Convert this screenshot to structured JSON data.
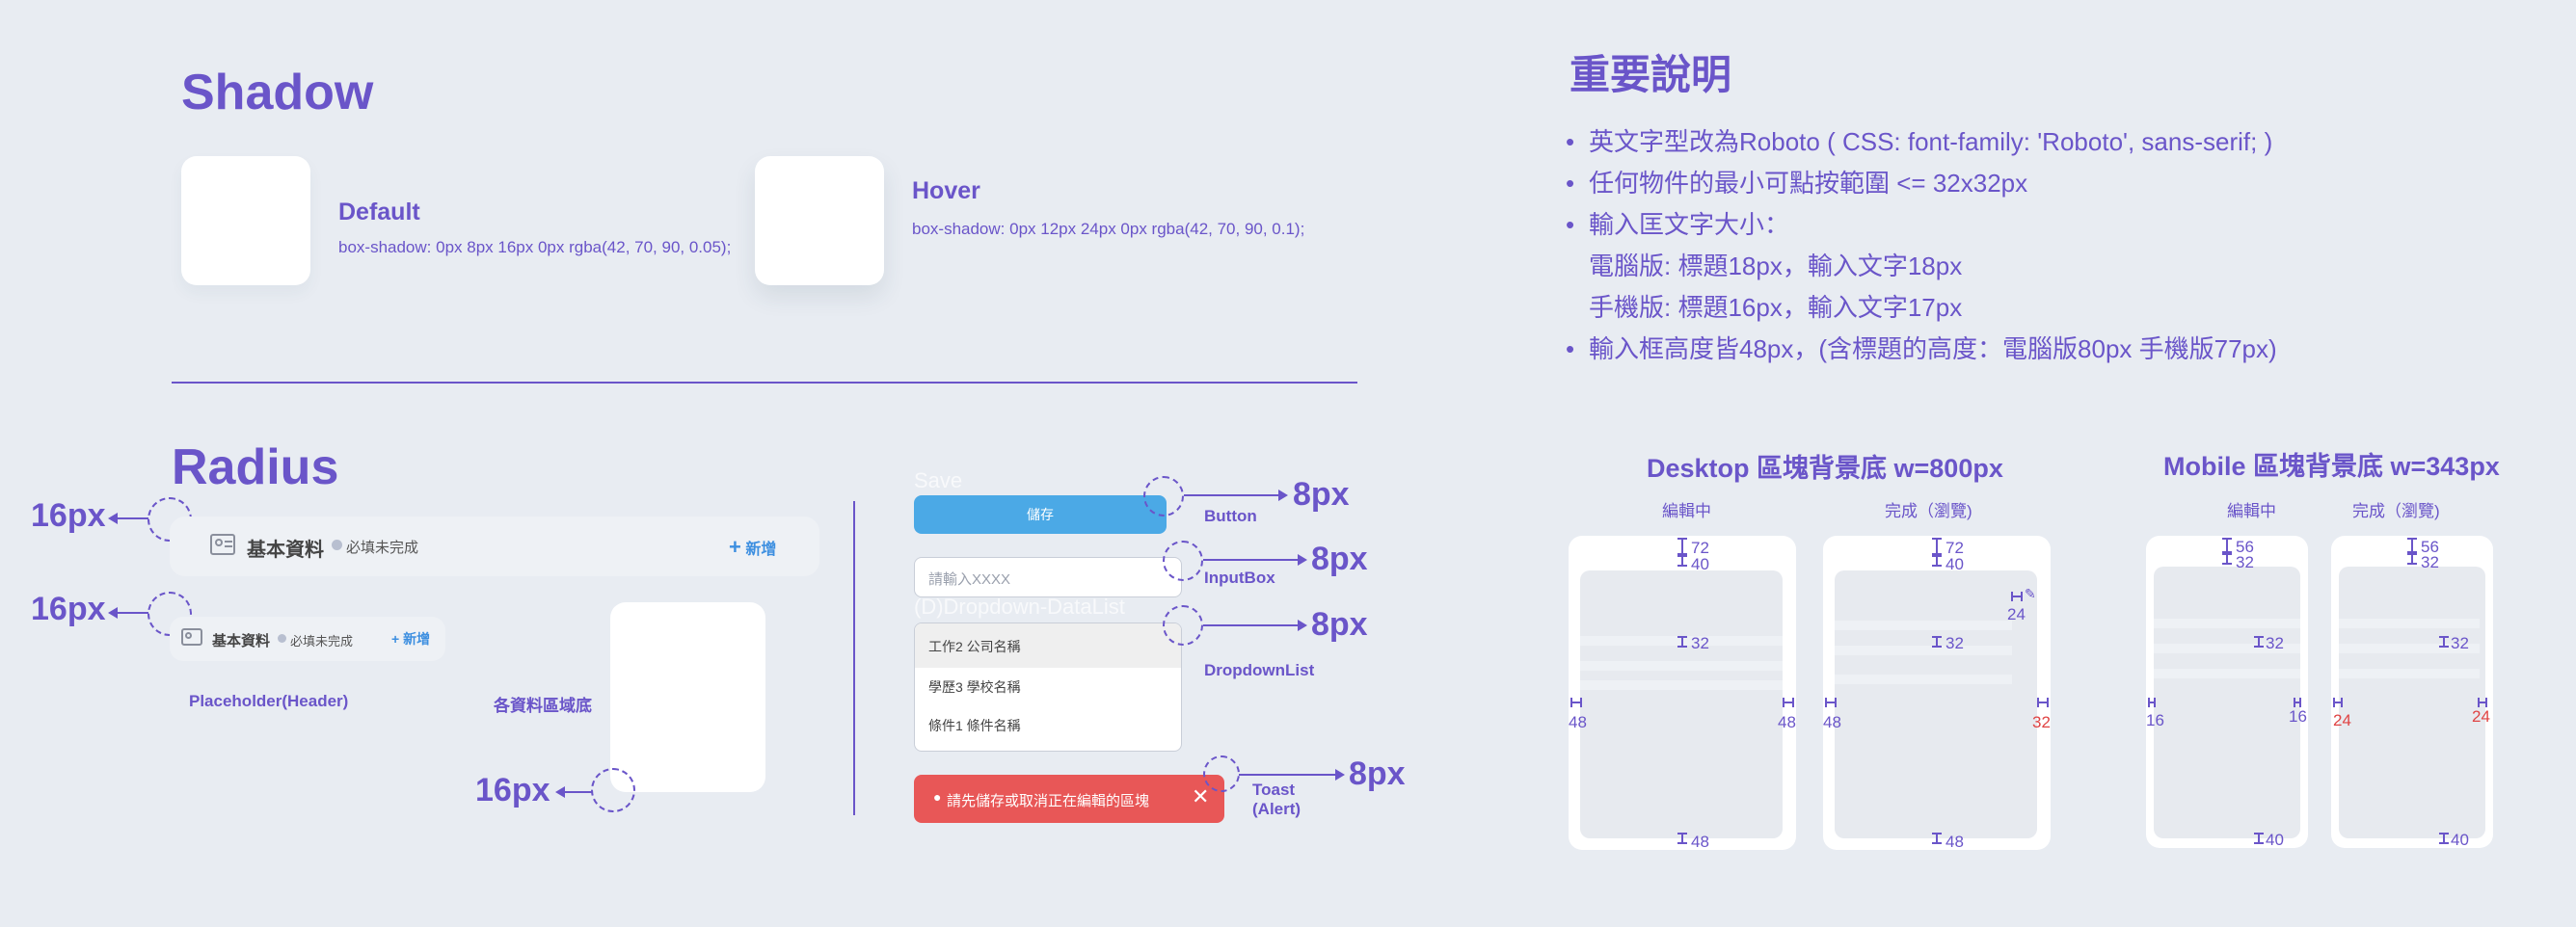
{
  "shadow": {
    "title": "Shadow",
    "default_label": "Default",
    "default_css": "box-shadow: 0px 8px 16px 0px rgba(42, 70, 90, 0.05);",
    "hover_label": "Hover",
    "hover_css": "box-shadow: 0px 12px 24px 0px rgba(42, 70, 90, 0.1);"
  },
  "radius": {
    "title": "Radius",
    "px16": "16px",
    "header_title": "基本資料",
    "header_status": "必填未完成",
    "header_add": "新增",
    "placeholder_label": "Placeholder(Header)",
    "block_label": "各資料區域底"
  },
  "components": {
    "ghost_save": "Save",
    "button_label": "儲存",
    "button_name": "Button",
    "input_placeholder": "請輸入XXXX",
    "input_name": "InputBox",
    "ghost_dropdown": "(D)Dropdown-DataList",
    "dropdown_items": [
      "工作2 公司名稱",
      "學歷3 學校名稱",
      "條件1 條件名稱"
    ],
    "dropdown_name": "DropdownList",
    "toast_text": "請先儲存或取消正在編輯的區塊",
    "toast_name_1": "Toast",
    "toast_name_2": "(Alert)",
    "px8": "8px"
  },
  "notes": {
    "title": "重要說明",
    "lines": [
      "英文字型改為Roboto ( CSS: font-family: 'Roboto', sans-serif; )",
      "任何物件的最小可點按範圍 <= 32x32px",
      "輸入匡文字大小：",
      "電腦版: 標題18px，輸入文字18px",
      "手機版: 標題16px，輸入文字17px",
      "輸入框高度皆48px，(含標題的高度：電腦版80px 手機版77px)"
    ]
  },
  "layouts": {
    "desktop_title": "Desktop 區塊背景底 w=800px",
    "mobile_title": "Mobile 區塊背景底 w=343px",
    "editing": "編輯中",
    "done": "完成（瀏覽)",
    "d_edit": {
      "top": "72",
      "top2": "40",
      "mid": "32",
      "left": "48",
      "right": "48",
      "bottom": "48"
    },
    "d_done": {
      "top": "72",
      "top2": "40",
      "edit": "24",
      "mid": "32",
      "left": "48",
      "right": "32",
      "bottom": "48"
    },
    "m_edit": {
      "top": "56",
      "top2": "32",
      "mid": "32",
      "left": "16",
      "right": "16",
      "bottom": "40"
    },
    "m_done": {
      "top": "56",
      "top2": "32",
      "mid": "32",
      "left": "24",
      "right": "24",
      "bottom": "40"
    }
  },
  "colors": {
    "accent": "#6a55c9",
    "button_blue": "#4ba9e6",
    "toast_red": "#e85757",
    "warn_red": "#e04444",
    "background": "#e8ecf2"
  }
}
